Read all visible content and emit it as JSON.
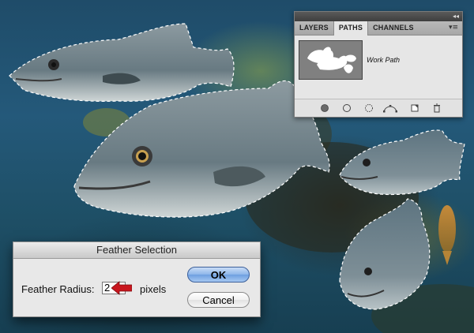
{
  "paths_panel": {
    "collapse_glyph": "◂◂",
    "tabs": [
      "LAYERS",
      "PATHS",
      "CHANNELS"
    ],
    "active_tab": "PATHS",
    "menu_glyph": "▾≡",
    "path_name": "Work Path",
    "footer_icons": [
      "fill-path-icon",
      "stroke-path-icon",
      "load-selection-icon",
      "make-work-path-icon",
      "new-path-icon",
      "trash-icon"
    ]
  },
  "feather_dialog": {
    "title": "Feather Selection",
    "radius_label": "Feather Radius:",
    "radius_value": "2",
    "unit": "pixels",
    "ok_label": "OK",
    "cancel_label": "Cancel"
  },
  "colors": {
    "water": "#24597a",
    "fish": "#6f7e84",
    "selection": "#ffffff",
    "arrow": "#c8161e",
    "ok_button": "#8db6ea"
  }
}
